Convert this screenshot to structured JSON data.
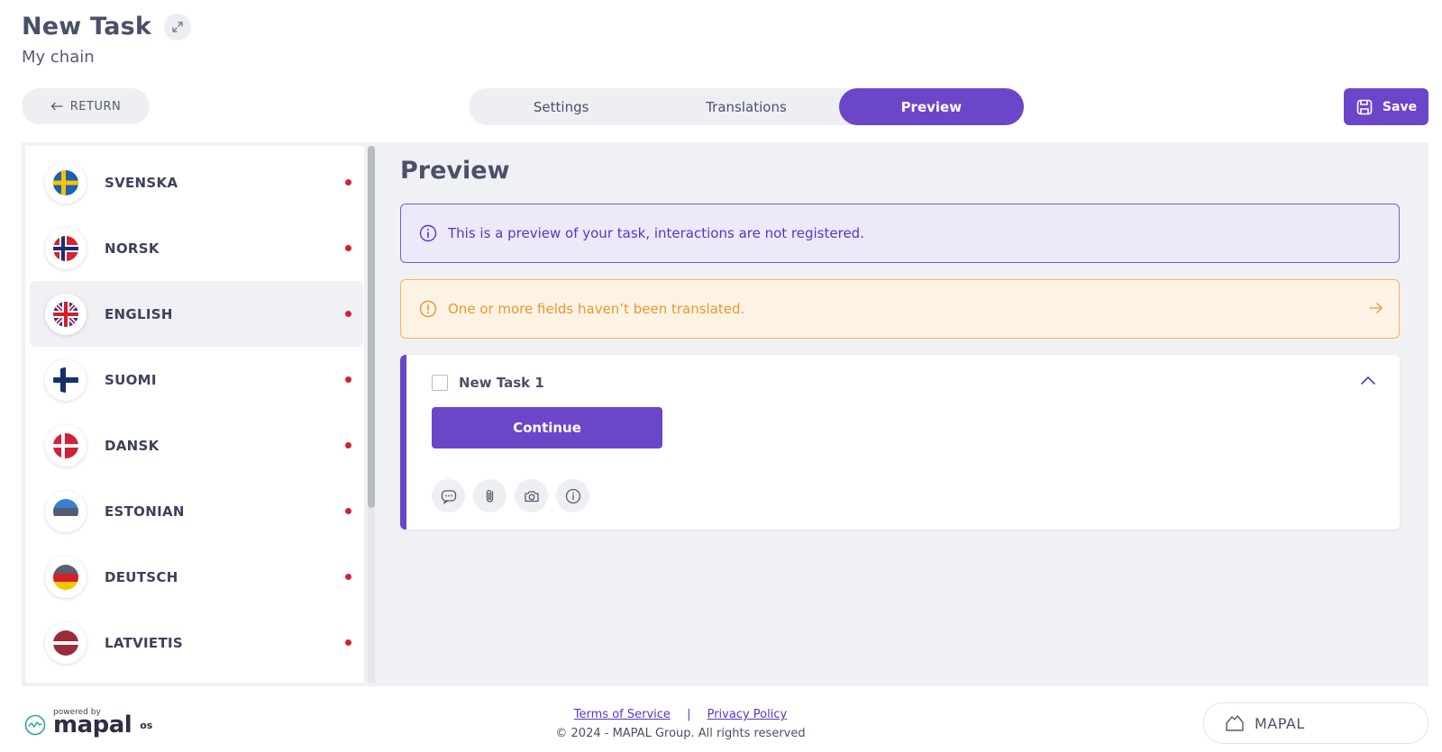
{
  "header": {
    "title": "New Task",
    "subtitle": "My chain"
  },
  "toolbar": {
    "return_label": "RETURN",
    "save_label": "Save"
  },
  "tabs": [
    {
      "label": "Settings",
      "active": false
    },
    {
      "label": "Translations",
      "active": false
    },
    {
      "label": "Preview",
      "active": true
    }
  ],
  "languages": [
    {
      "label": "SVENSKA",
      "flag": "sweden-flag-icon",
      "selected": false,
      "status": "untranslated"
    },
    {
      "label": "NORSK",
      "flag": "norway-flag-icon",
      "selected": false,
      "status": "untranslated"
    },
    {
      "label": "ENGLISH",
      "flag": "uk-flag-icon",
      "selected": true,
      "status": "untranslated"
    },
    {
      "label": "SUOMI",
      "flag": "finland-flag-icon",
      "selected": false,
      "status": "untranslated"
    },
    {
      "label": "DANSK",
      "flag": "denmark-flag-icon",
      "selected": false,
      "status": "untranslated"
    },
    {
      "label": "ESTONIAN",
      "flag": "estonia-flag-icon",
      "selected": false,
      "status": "untranslated"
    },
    {
      "label": "DEUTSCH",
      "flag": "germany-flag-icon",
      "selected": false,
      "status": "untranslated"
    },
    {
      "label": "LATVIETIS",
      "flag": "latvia-flag-icon",
      "selected": false,
      "status": "untranslated"
    }
  ],
  "preview": {
    "title": "Preview",
    "info_alert": "This is a preview of your task, interactions are not registered.",
    "warning_alert": "One or more fields haven’t been translated.",
    "task": {
      "name": "New Task 1",
      "continue_label": "Continue",
      "actions": [
        "comment-icon",
        "attachment-icon",
        "camera-icon",
        "info-icon"
      ]
    }
  },
  "footer": {
    "powered_by": "powered by",
    "brand": "mapal",
    "brand_suffix": "os",
    "terms_label": "Terms of Service",
    "separator": "|",
    "privacy_label": "Privacy Policy",
    "copyright": "© 2024 - MAPAL Group. All rights reserved",
    "company_label": "MAPAL"
  },
  "colors": {
    "accent": "#6b46c9",
    "status_dot": "#d3203a",
    "warning": "#e8972e",
    "workspace_bg": "#f0f1f4"
  }
}
